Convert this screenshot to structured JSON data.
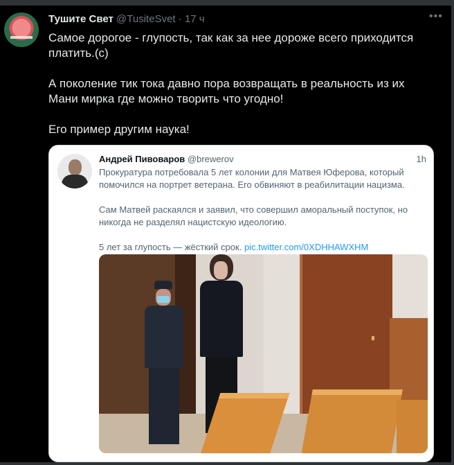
{
  "tweet": {
    "author_name": "Тушите Свет",
    "author_handle": "@TusiteSvet",
    "separator": "·",
    "time": "17 ч",
    "paragraphs": [
      "Самое дорогое - глупость, так как за нее дороже всего приходится платить.(с)",
      "А поколение тик тока давно пора возвращать в реальность из их Мани мирка где можно творить что угодно!",
      "Его пример другим наука!"
    ]
  },
  "quoted_tweet": {
    "author_name": "Андрей Пивоваров",
    "author_handle": "@brewerov",
    "time": "1h",
    "paragraphs": [
      "Прокуратура потребовала 5 лет колонии для Матвея Юферова, который помочился на портрет ветерана. Его обвиняют в реабилитации нацизма.",
      "Сам Матвей раскаялся и заявил, что совершил аморальный поступок, но никогда не разделял нацистскую идеологию."
    ],
    "last_line_text": "5 лет за глупость — жёсткий срок.",
    "link": "pic.twitter.com/0XDHHAWXHM"
  },
  "icons": {
    "more": "more-options-icon",
    "avatar": "profile-avatar",
    "media": "courtroom-photo"
  },
  "colors": {
    "background": "#000000",
    "text": "#e7e9ea",
    "muted": "#71767b",
    "link": "#1d9bf0",
    "card": "#ffffff"
  }
}
